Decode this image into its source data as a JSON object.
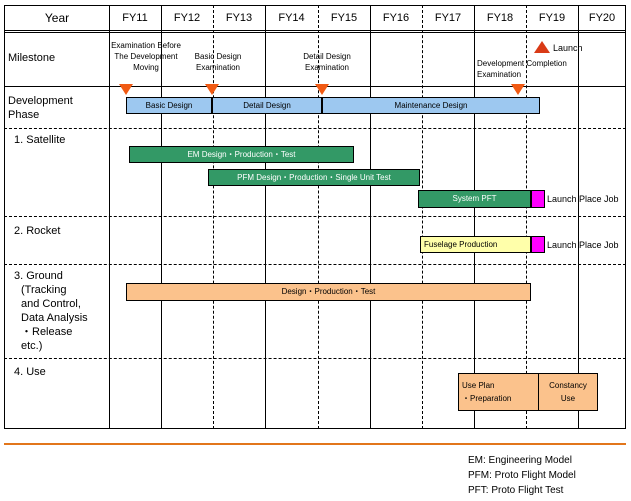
{
  "chart_data": {
    "type": "table",
    "title": "Satellite Development Schedule Gantt Chart",
    "x_axis_label": "Year",
    "categories": [
      "FY11",
      "FY12",
      "FY13",
      "FY14",
      "FY15",
      "FY16",
      "FY17",
      "FY18",
      "FY19",
      "FY20"
    ],
    "rows": [
      {
        "name": "Milestone",
        "items": [
          {
            "label": "Examination Before The Development Moving",
            "marker": "triangle-down",
            "at": "FY11"
          },
          {
            "label": "Basic Design Examination",
            "marker": "triangle-down",
            "at": "FY12-FY13"
          },
          {
            "label": "Detail Design Examination",
            "marker": "triangle-down",
            "at": "FY14"
          },
          {
            "label": "Development Completion Examination",
            "marker": "triangle-down",
            "at": "FY18-FY19"
          },
          {
            "label": "Launch",
            "marker": "triangle-up",
            "at": "FY19"
          }
        ]
      },
      {
        "name": "Development Phase",
        "bars": [
          {
            "label": "Basic Design",
            "color": "#9DC8F0",
            "start": "FY11",
            "end": "FY12"
          },
          {
            "label": "Detail Design",
            "color": "#9DC8F0",
            "start": "FY12",
            "end": "FY14"
          },
          {
            "label": "Maintenance Design",
            "color": "#9DC8F0",
            "start": "FY14",
            "end": "FY19"
          }
        ]
      },
      {
        "name": "1. Satellite",
        "bars": [
          {
            "label": "EM Design・Production・Test",
            "color": "#339966",
            "start": "FY12",
            "end": "FY15"
          },
          {
            "label": "PFM Design・Production・Single Unit Test",
            "color": "#339966",
            "start": "FY13",
            "end": "FY17"
          },
          {
            "label": "System PFT",
            "color": "#339966",
            "start": "FY17",
            "end": "FY19"
          },
          {
            "label": "",
            "color": "#FF00FF",
            "start": "FY19",
            "end": "FY19"
          },
          {
            "label": "Launch Place Job",
            "color": "none",
            "start": "FY19",
            "end": "FY20"
          }
        ]
      },
      {
        "name": "2. Rocket",
        "bars": [
          {
            "label": "Fuselage Production",
            "color": "#FFFFAA",
            "start": "FY17",
            "end": "FY19"
          },
          {
            "label": "",
            "color": "#FF00FF",
            "start": "FY19",
            "end": "FY19"
          },
          {
            "label": "Launch Place Job",
            "color": "none",
            "start": "FY19",
            "end": "FY20"
          }
        ]
      },
      {
        "name": "3. Ground (Tracking and Control, Data Analysis ・Release etc.)",
        "bars": [
          {
            "label": "Design・Production・Test",
            "color": "#FBC28C",
            "start": "FY12",
            "end": "FY19"
          }
        ]
      },
      {
        "name": "4. Use",
        "bars": [
          {
            "label": "Use Plan ・Preparation",
            "color": "#FBC28C",
            "start": "FY18",
            "end": "FY19"
          },
          {
            "label": "Constancy Use",
            "color": "#FBC28C",
            "start": "FY19",
            "end": "FY20"
          }
        ]
      }
    ]
  },
  "header": {
    "year_label": "Year",
    "years": [
      "FY11",
      "FY12",
      "FY13",
      "FY14",
      "FY15",
      "FY16",
      "FY17",
      "FY18",
      "FY19",
      "FY20"
    ]
  },
  "rows": {
    "milestone": "Milestone",
    "development_phase_l1": "Development",
    "development_phase_l2": "Phase",
    "satellite": "1. Satellite",
    "rocket": "2. Rocket",
    "ground_l1": "3. Ground",
    "ground_l2": "(Tracking",
    "ground_l3": "and Control,",
    "ground_l4": "Data Analysis",
    "ground_l5": "・Release",
    "ground_l6": "etc.)",
    "use": "4. Use"
  },
  "milestones": {
    "m1_l1": "Examination Before",
    "m1_l2": "The Development",
    "m1_l3": "Moving",
    "m2_l1": "Basic Design",
    "m2_l2": "Examination",
    "m3_l1": "Detail Design",
    "m3_l2": "Examination",
    "m4_l1": "Development Completion",
    "m4_l2": "Examination",
    "launch": "Launch"
  },
  "bars": {
    "basic_design": "Basic Design",
    "detail_design": "Detail Design",
    "maintenance_design": "Maintenance Design",
    "em_design": "EM Design・Production・Test",
    "pfm_design": "PFM Design・Production・Single Unit Test",
    "system_pft": "System PFT",
    "launch_place_job_sat": "Launch Place Job",
    "fuselage_production": "Fuselage Production",
    "launch_place_job_rocket": "Launch Place Job",
    "ground_design": "Design・Production・Test",
    "use_plan_l1": "Use Plan",
    "use_plan_l2": "・Preparation",
    "constancy_l1": "Constancy",
    "constancy_l2": "Use"
  },
  "legend": {
    "line1": "EM: Engineering Model",
    "line2": "PFM: Proto Flight Model",
    "line3": "PFT: Proto Flight Test"
  },
  "colors": {
    "blue_bar": "#9DC8F0",
    "green_bar": "#339966",
    "magenta_bar": "#FF00FF",
    "yellow_bar": "#FFFFAA",
    "orange_bar": "#FBC28C",
    "triangle_down": "#F15A13",
    "triangle_up": "#D93A16",
    "divider": "#E2761B"
  }
}
